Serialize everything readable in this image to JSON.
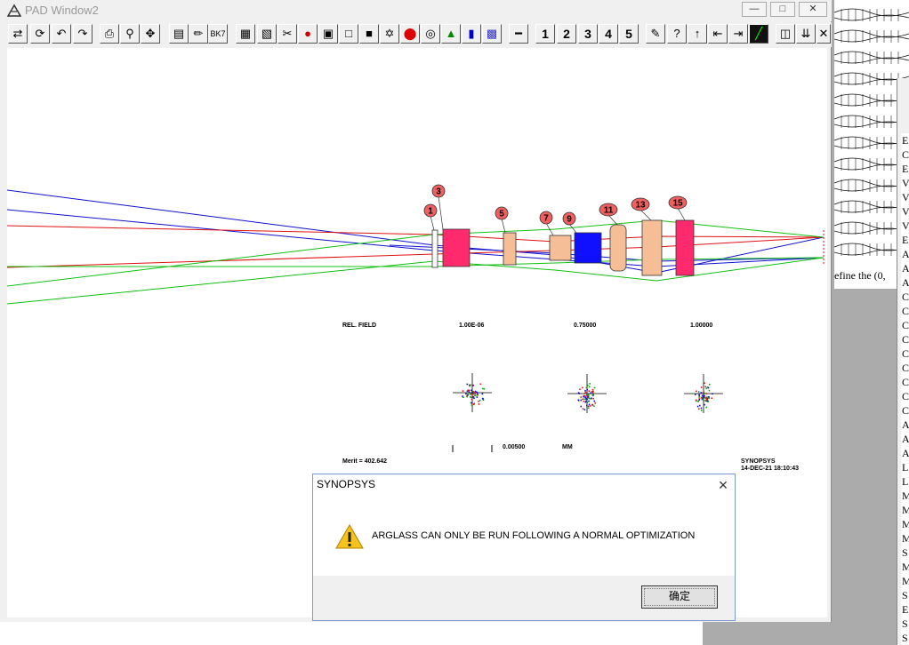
{
  "window": {
    "title": "PAD Window2",
    "minimize_icon": "minimize-icon",
    "maximize_icon": "maximize-icon",
    "close_icon": "close-icon"
  },
  "toolbar": {
    "icons": [
      "settings-sliders-icon",
      "refresh-icon",
      "undo-icon",
      "redo-icon",
      "print-icon",
      "zoom-icon",
      "fit-icon",
      "table-icon",
      "plot-icon",
      "glass-catalog-icon",
      "grid-icon",
      "grid2-icon",
      "scissors-icon",
      "colors-icon",
      "camera-icon",
      "white-square-icon",
      "black-square-icon",
      "expand-icon",
      "red-dot-icon",
      "circle-icon",
      "tree-icon",
      "bars-icon",
      "pattern-icon",
      "ruler-icon"
    ],
    "bk7_label": "BK7",
    "page_numbers": [
      "1",
      "2",
      "3",
      "4",
      "5"
    ],
    "right_icons": [
      "pen-icon",
      "help-icon",
      "up-arrow-icon",
      "left-limit-icon",
      "right-limit-icon",
      "chart-icon",
      "lens-icon",
      "down-arrows-icon",
      "close-x-icon"
    ]
  },
  "plot": {
    "surface_labels": [
      "1",
      "3",
      "5",
      "7",
      "9",
      "11",
      "13",
      "15"
    ],
    "rel_field_label": "REL. FIELD",
    "fields": [
      "1.00E-06",
      "0.75000",
      "1.00000"
    ],
    "scale_value": "0.00500",
    "scale_unit": "MM",
    "merit": "Merit = 402.642",
    "brand": "SYNOPSYS",
    "date": "14-DEC-21  18:10:43",
    "colors": {
      "ray_blue": "#1010d0",
      "ray_red": "#e01010",
      "ray_green": "#10c010",
      "lens_magenta": "#ff2a6d",
      "lens_tan": "#f5be96",
      "lens_blue": "#1010ff",
      "label_fill": "#f06060"
    }
  },
  "background": {
    "partial_text": "efine the (0,",
    "list_letters": [
      "E",
      "C",
      "E",
      "V",
      "V",
      "V",
      "V",
      "E",
      "A",
      "A",
      "A",
      "C",
      "C",
      "C",
      "C",
      "C",
      "C",
      "C",
      "C",
      "C",
      "A",
      "A",
      "A",
      "L",
      "L",
      "M",
      "M",
      "M",
      "M",
      "S",
      "M",
      "M",
      "S",
      "E",
      "S",
      "S"
    ]
  },
  "dialog": {
    "title": "SYNOPSYS",
    "message": "ARGLASS CAN ONLY BE RUN FOLLOWING A NORMAL OPTIMIZATION",
    "ok_label": "确定",
    "icon": "warning-icon"
  }
}
